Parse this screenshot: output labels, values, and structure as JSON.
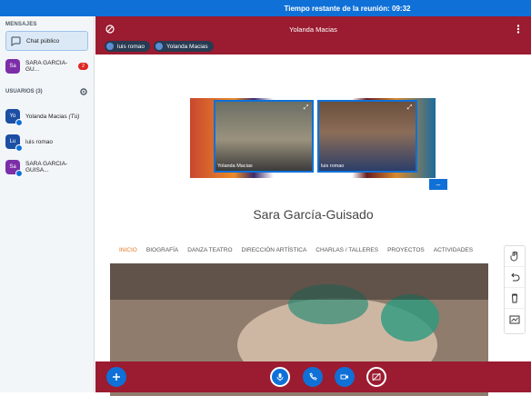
{
  "topbar": {
    "time_label": "Tiempo restante de la reunión: 09:32"
  },
  "sidebar": {
    "messages_title": "MENSAJES",
    "public_chat": "Chat público",
    "private_chat": {
      "initials": "Sa",
      "name": "SARA GARCIA-GU...",
      "badge": "2"
    },
    "users_title": "USUARIOS (3)",
    "users": [
      {
        "initials": "Yo",
        "name": "Yolanda Macias",
        "suffix": "(Tú)",
        "color": "#1c4fa3"
      },
      {
        "initials": "Lu",
        "name": "luis romao",
        "suffix": "",
        "color": "#1c4fa3"
      },
      {
        "initials": "Sa",
        "name": "SARA GARCIA-GUISA...",
        "suffix": "",
        "color": "#7b2ea8"
      }
    ]
  },
  "main": {
    "title": "Yolanda Macias",
    "talkers": [
      "luis romao",
      "Yolanda Macias"
    ],
    "videos": [
      {
        "name": "Yolanda Macias"
      },
      {
        "name": "luis romao"
      }
    ],
    "minimize_label": "–",
    "site_title": "Sara García-Guisado",
    "nav": [
      "INICIO",
      "BIOGRAFÍA",
      "DANZA TEATRO",
      "DIRECCIÓN ARTÍSTICA",
      "CHARLAS / TALLERES",
      "PROYECTOS",
      "ACTIVIDADES"
    ],
    "tools": [
      "hand-icon",
      "undo-icon",
      "trash-icon",
      "chart-icon"
    ]
  },
  "colors": {
    "accent": "#0f70d7",
    "brand": "#9b1b30",
    "badge": "#df2721"
  }
}
